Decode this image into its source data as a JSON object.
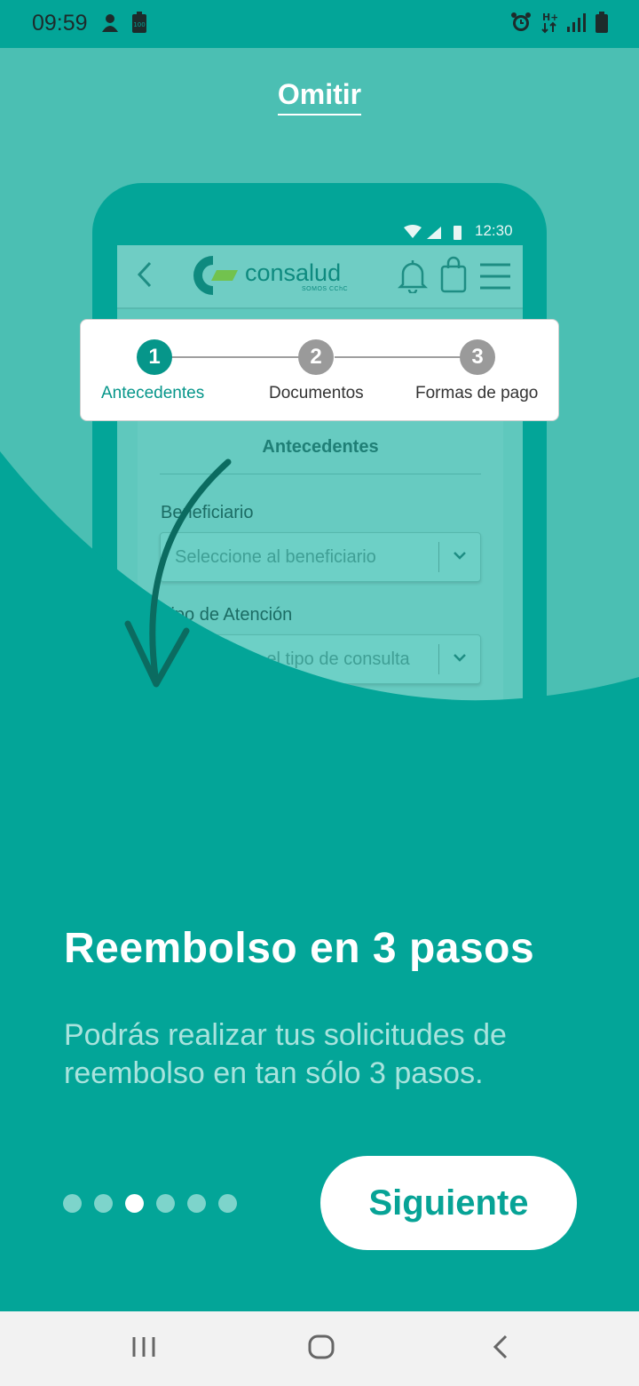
{
  "status_bar": {
    "time": "09:59",
    "left_icons": [
      "notification-icon",
      "battery-saver-icon"
    ],
    "right_icons": [
      "alarm-icon",
      "data-h-plus-icon",
      "signal-icon",
      "battery-icon"
    ]
  },
  "skip": {
    "label": "Omitir"
  },
  "illustration": {
    "phone_time": "12:30",
    "app_brand": "consalud",
    "app_brand_sub": "SOMOS CChC",
    "steps": [
      {
        "number": "1",
        "label": "Antecedentes",
        "active": true
      },
      {
        "number": "2",
        "label": "Documentos",
        "active": false
      },
      {
        "number": "3",
        "label": "Formas de pago",
        "active": false
      }
    ],
    "form_title": "Antecedentes",
    "field1_label": "Beneficiario",
    "field1_placeholder": "Seleccione al beneficiario",
    "field2_label": "Tipo de Atención",
    "field2_placeholder": "Seleccione el tipo de consulta"
  },
  "headline": "Reembolso en 3 pasos",
  "subtext": "Podrás realizar tus solicitudes de reembolso en tan sólo 3 pasos.",
  "pagination": {
    "total": 6,
    "active_index": 2
  },
  "next_button": {
    "label": "Siguiente"
  },
  "nav_bar": {
    "icons": [
      "recent-apps-icon",
      "home-icon",
      "back-icon"
    ]
  },
  "colors": {
    "primary": "#03A598",
    "light": "#4BBFB3",
    "accent_dark": "#0e8a7f",
    "white": "#ffffff"
  }
}
